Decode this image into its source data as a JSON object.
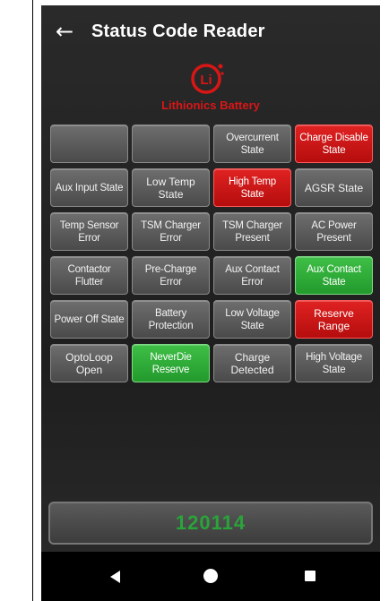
{
  "app_bar": {
    "back_icon": "arrow-left-icon",
    "title": "Status Code Reader"
  },
  "logo": {
    "mark": "Li",
    "brand": "Lithionics Battery",
    "brand_color": "#d81616"
  },
  "status_grid": [
    {
      "label": "",
      "state": "off"
    },
    {
      "label": "",
      "state": "off"
    },
    {
      "label": "Overcurrent\nState",
      "state": "off"
    },
    {
      "label": "Charge Disable\nState",
      "state": "red"
    },
    {
      "label": "Aux Input State",
      "state": "off"
    },
    {
      "label": "Low Temp State",
      "state": "off"
    },
    {
      "label": "High Temp State",
      "state": "red"
    },
    {
      "label": "AGSR State",
      "state": "off"
    },
    {
      "label": "Temp Sensor\nError",
      "state": "off"
    },
    {
      "label": "TSM Charger\nError",
      "state": "off"
    },
    {
      "label": "TSM Charger\nPresent",
      "state": "off"
    },
    {
      "label": "AC Power\nPresent",
      "state": "off"
    },
    {
      "label": "Contactor\nFlutter",
      "state": "off"
    },
    {
      "label": "Pre-Charge Error",
      "state": "off"
    },
    {
      "label": "Aux Contact\nError",
      "state": "off"
    },
    {
      "label": "Aux Contact\nState",
      "state": "green"
    },
    {
      "label": "Power Off State",
      "state": "off"
    },
    {
      "label": "Battery\nProtection",
      "state": "off"
    },
    {
      "label": "Low Voltage\nState",
      "state": "off"
    },
    {
      "label": "Reserve Range",
      "state": "red"
    },
    {
      "label": "OptoLoop Open",
      "state": "off"
    },
    {
      "label": "NeverDie\nReserve",
      "state": "green"
    },
    {
      "label": "Charge\nDetected",
      "state": "off"
    },
    {
      "label": "High Voltage\nState",
      "state": "off"
    }
  ],
  "code_display": {
    "value": "120114",
    "color": "#2aa33a"
  },
  "nav_bar": {
    "back_icon": "nav-back-triangle-icon",
    "home_icon": "nav-home-circle-icon",
    "recents_icon": "nav-recents-square-icon"
  },
  "colors": {
    "active_red": "#c81414",
    "active_green": "#2fae38",
    "inactive_gray": "#5a5a5a",
    "background": "#222222"
  }
}
